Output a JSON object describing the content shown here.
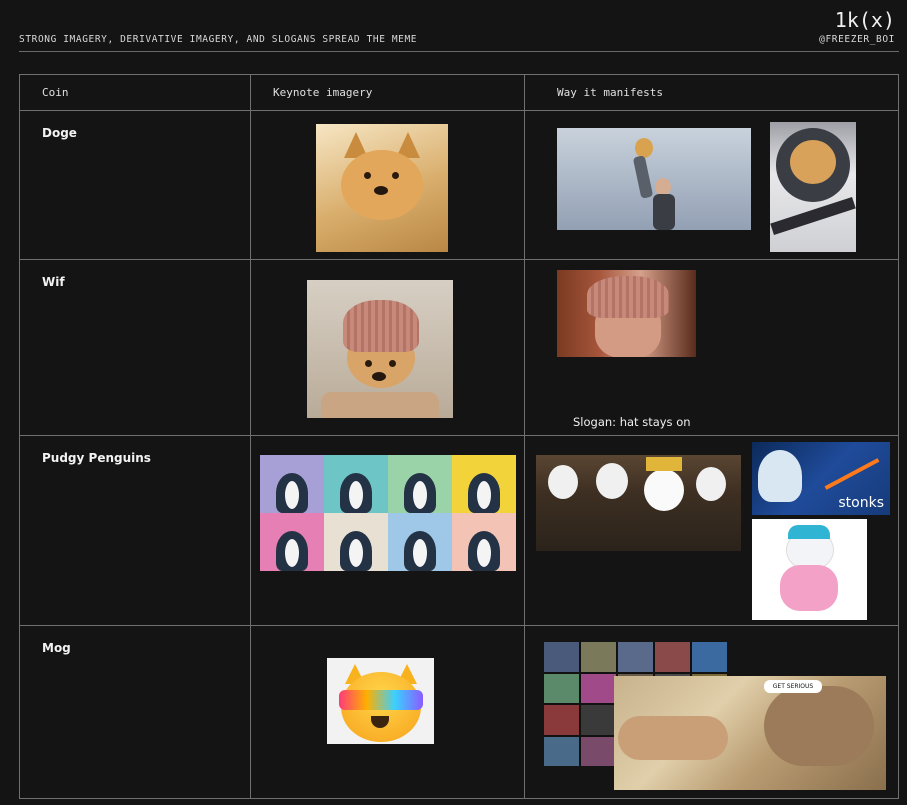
{
  "header": {
    "title": "STRONG IMAGERY, DERIVATIVE IMAGERY, AND SLOGANS SPREAD THE MEME",
    "logo": "1k(x)",
    "handle": "@FREEZER_BOI"
  },
  "table": {
    "columns": [
      "Coin",
      "Keynote imagery",
      "Way it manifests"
    ],
    "rows": [
      {
        "coin": "Doge",
        "caption": ""
      },
      {
        "coin": "Wif",
        "caption": "Slogan: hat stays on"
      },
      {
        "coin": "Pudgy Penguins",
        "caption": ""
      },
      {
        "coin": "Mog",
        "caption": ""
      }
    ]
  },
  "images": {
    "doge_keynote": "shiba-inu-photo",
    "doge_manifest_1": "doge-lion-king-lift-meme",
    "doge_manifest_2": "doge-astronaut-helmet",
    "wif_keynote": "dog-wearing-pink-knit-hat",
    "wif_manifest": "man-wearing-pink-knit-hat",
    "pudgy_keynote": "pudgy-penguins-nft-grid",
    "pudgy_manifest_1": "penguin-army-crowd",
    "pudgy_manifest_2": "penguin-stonks-meme",
    "pudgy_manifest_3": "pink-penguin-plush",
    "mog_keynote": "cat-face-rainbow-visor-emoji",
    "mog_manifest_1": "mog-avatar-collage",
    "mog_manifest_2": "creation-of-adam-parody",
    "mog_speech": "GET SERIOUS",
    "stonks_text": "stonks"
  },
  "colors": {
    "background": "#141414",
    "text": "#e8e8e8",
    "border": "#707070"
  }
}
